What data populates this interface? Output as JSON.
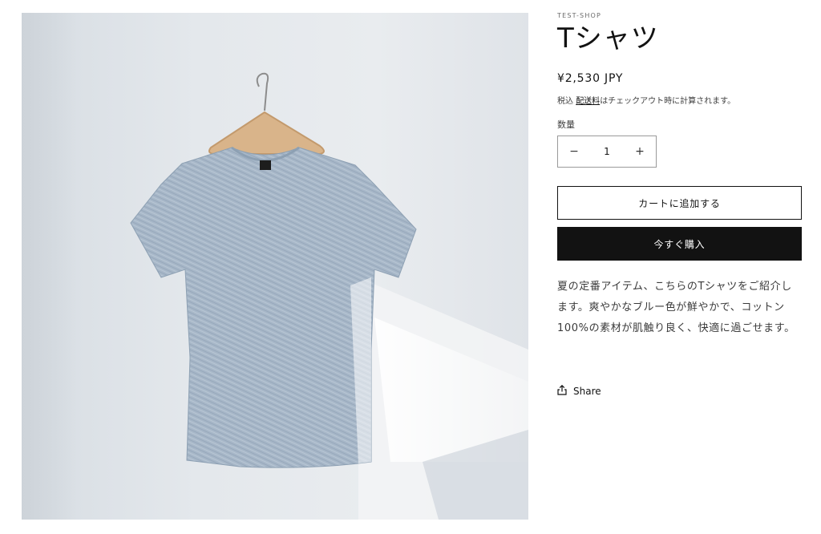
{
  "product": {
    "image_alt": "Tシャツ",
    "vendor": "TEST-SHOP",
    "title": "Tシャツ",
    "price": "¥2,530 JPY",
    "tax_prefix": "税込",
    "shipping_link": "配送料",
    "tax_suffix": "はチェックアウト時に計算されます。",
    "quantity_label": "数量",
    "quantity_value": "1",
    "decrease_symbol": "−",
    "increase_symbol": "+",
    "add_to_cart": "カートに追加する",
    "buy_now": "今すぐ購入",
    "description": "夏の定番アイテム、こちらのTシャツをご紹介します。爽やかなブルー色が鮮やかで、コットン100%の素材が肌触り良く、快適に過ごせます。",
    "share": "Share"
  },
  "icons": {
    "share": "share-icon"
  },
  "colors": {
    "text": "#121212",
    "buy_now_bg": "#121212",
    "shirt": "#a9b9c9"
  }
}
